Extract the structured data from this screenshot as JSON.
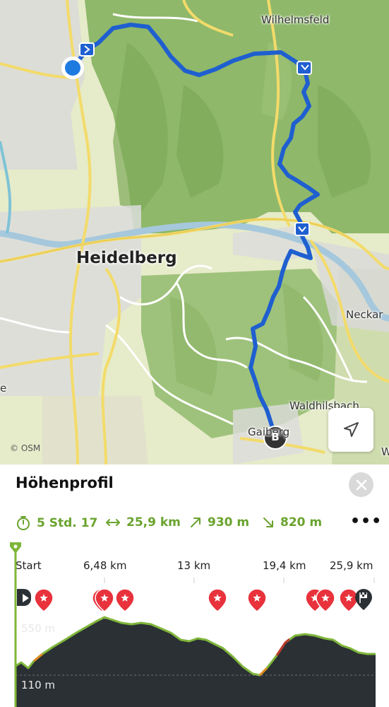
{
  "map": {
    "city": "Heidelberg",
    "places": [
      {
        "name": "Wilhelmsfeld"
      },
      {
        "name": "Neckar"
      },
      {
        "name": "Waldhilsbach"
      },
      {
        "name": "Gaiberg"
      },
      {
        "name": "e"
      },
      {
        "name": "W"
      }
    ],
    "attribution": "© OSM",
    "end_marker": "B",
    "locate_icon": "navigation-arrow-icon",
    "route_color": "#1f5fd0",
    "start_dot_color": "#1f7ae0"
  },
  "panel": {
    "title": "Höhenprofil",
    "close_icon": "close-icon",
    "stats": {
      "duration": "5 Std. 17",
      "distance": "25,9 km",
      "ascent": "930 m",
      "descent": "820 m"
    },
    "more_icon": "more-horizontal-icon",
    "more_label": "•••",
    "axis_ticks": [
      "Start",
      "6,48 km",
      "13 km",
      "19,4 km",
      "25,9 km"
    ],
    "alt_labels": [
      "550 m",
      "110 m"
    ],
    "accent_color": "#6aa32e",
    "poi_color": "#e8323c"
  }
}
